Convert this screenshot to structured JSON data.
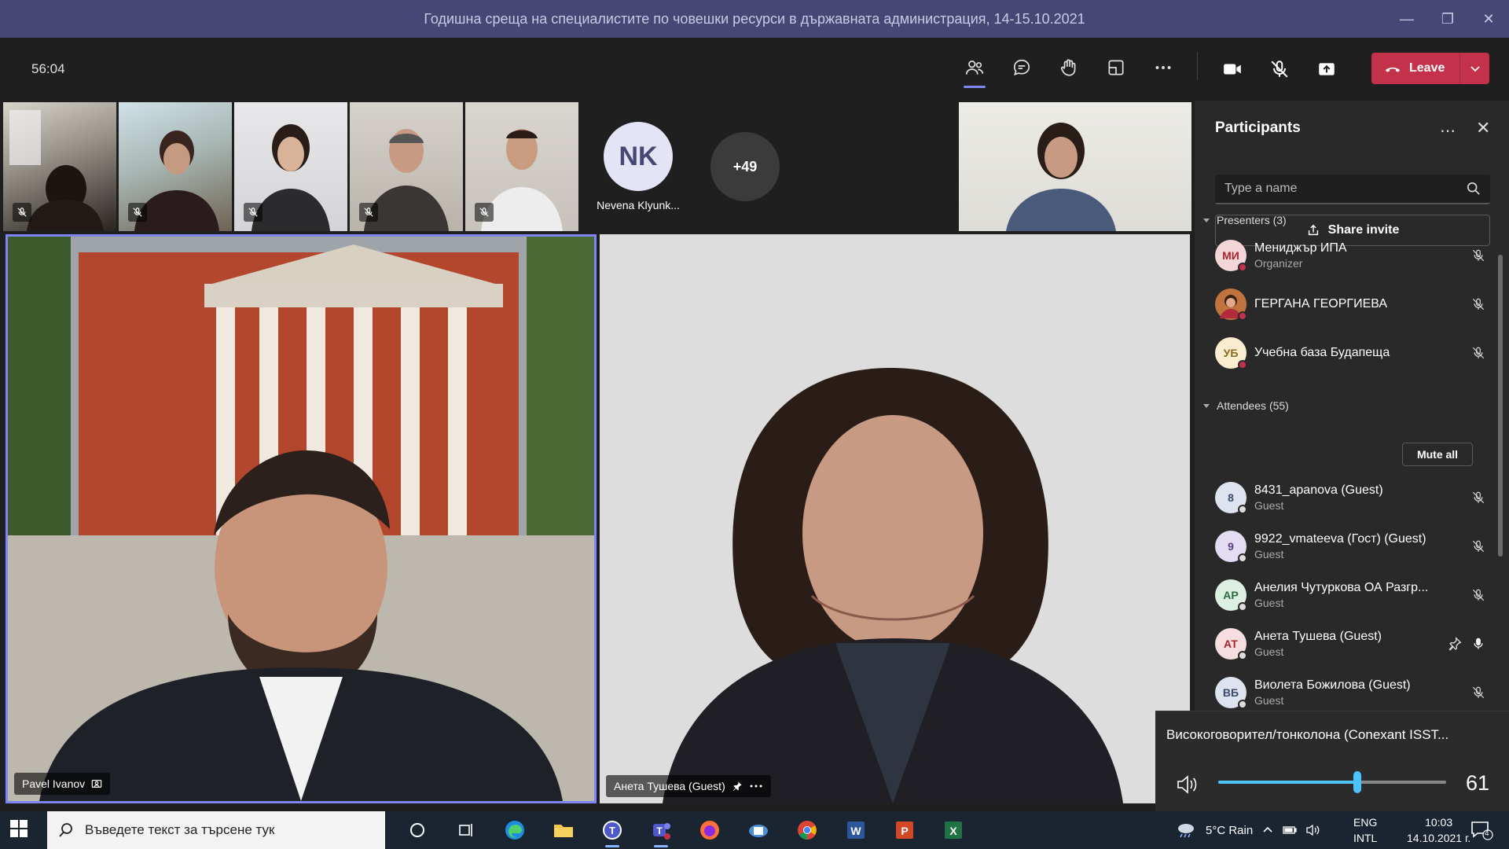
{
  "window": {
    "title": "Годишна среща на специалистите по човешки ресурси в държавната администрация, 14-15.10.2021"
  },
  "toolbar": {
    "timer": "56:04",
    "leave_label": "Leave"
  },
  "strip": {
    "avatar_initials": "NK",
    "avatar_name": "Nevena Klyunk...",
    "more_count": "+49"
  },
  "stage": {
    "left_name": "Pavel Ivanov",
    "right_name": "Анета Тушева (Guest)"
  },
  "panel": {
    "title": "Participants",
    "search_placeholder": "Type a name",
    "share_label": "Share invite",
    "presenters_label": "Presenters (3)",
    "attendees_label": "Attendees (55)",
    "mute_all_label": "Mute all",
    "presenters": [
      {
        "initials": "МИ",
        "name": "Мениджър ИПА",
        "role": "Organizer"
      },
      {
        "initials": "",
        "name": "ГЕРГАНА ГЕОРГИЕВА",
        "role": ""
      },
      {
        "initials": "УБ",
        "name": "Учебна база Будапеща",
        "role": ""
      }
    ],
    "attendees": [
      {
        "initials": "8",
        "name": "8431_apanova (Guest)",
        "role": "Guest"
      },
      {
        "initials": "9",
        "name": "9922_vmateeva (Гост) (Guest)",
        "role": "Guest"
      },
      {
        "initials": "АР",
        "name": "Анелия Чутуркова ОА Разгр...",
        "role": "Guest"
      },
      {
        "initials": "АТ",
        "name": "Анета Тушева (Guest)",
        "role": "Guest"
      },
      {
        "initials": "ВБ",
        "name": "Виолета Божилова (Guest)",
        "role": "Guest"
      }
    ]
  },
  "volume": {
    "device": "Високоговорител/тонколона (Conexant ISST...",
    "value": "61",
    "level": 0.61
  },
  "taskbar": {
    "search_placeholder": "Въведете текст за търсене тук",
    "weather": "5°C  Rain",
    "lang_line1": "ENG",
    "lang_line2": "INTL",
    "time": "10:03",
    "date": "14.10.2021 г.",
    "notif_count": "4"
  },
  "colors": {
    "accent": "#7f85f5",
    "leave": "#c4314b",
    "titlebar": "#464775",
    "volume": "#4cc2ff"
  }
}
